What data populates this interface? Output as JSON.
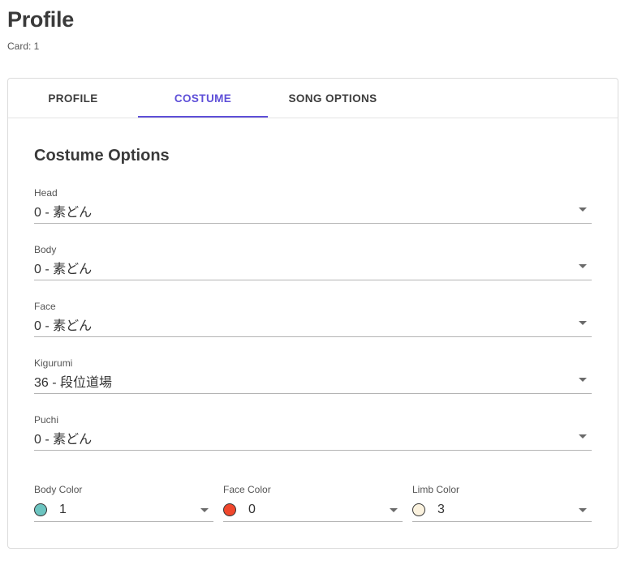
{
  "page": {
    "title": "Profile",
    "card_label": "Card: 1"
  },
  "tabs": [
    {
      "label": "PROFILE",
      "active": false
    },
    {
      "label": "COSTUME",
      "active": true
    },
    {
      "label": "SONG OPTIONS",
      "active": false
    }
  ],
  "accent_color": "#5e4fd8",
  "costume": {
    "section_title": "Costume Options",
    "fields": [
      {
        "label": "Head",
        "value": "0 - 素どん"
      },
      {
        "label": "Body",
        "value": "0 - 素どん"
      },
      {
        "label": "Face",
        "value": "0 - 素どん"
      },
      {
        "label": "Kigurumi",
        "value": "36 - 段位道場"
      },
      {
        "label": "Puchi",
        "value": "0 - 素どん"
      }
    ],
    "colors": [
      {
        "label": "Body Color",
        "value": "1",
        "swatch": "#6cc4c0"
      },
      {
        "label": "Face Color",
        "value": "0",
        "swatch": "#f0472c"
      },
      {
        "label": "Limb Color",
        "value": "3",
        "swatch": "#fbf2de"
      }
    ]
  }
}
